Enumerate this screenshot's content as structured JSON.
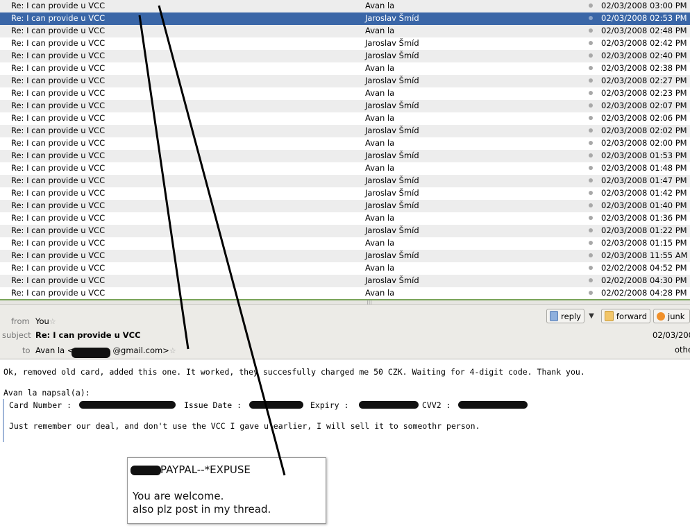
{
  "message_list": [
    {
      "subject": "Re: I can provide u VCC",
      "sender": "Avan la",
      "date": "02/03/2008 03:00 PM",
      "selected": false
    },
    {
      "subject": "Re: I can provide u VCC",
      "sender": "Jaroslav Šmíd",
      "date": "02/03/2008 02:53 PM",
      "selected": true
    },
    {
      "subject": "Re: I can provide u VCC",
      "sender": "Avan la",
      "date": "02/03/2008 02:48 PM",
      "selected": false
    },
    {
      "subject": "Re: I can provide u VCC",
      "sender": "Jaroslav Šmíd",
      "date": "02/03/2008 02:42 PM",
      "selected": false
    },
    {
      "subject": "Re: I can provide u VCC",
      "sender": "Jaroslav Šmíd",
      "date": "02/03/2008 02:40 PM",
      "selected": false
    },
    {
      "subject": "Re: I can provide u VCC",
      "sender": "Avan la",
      "date": "02/03/2008 02:38 PM",
      "selected": false
    },
    {
      "subject": "Re: I can provide u VCC",
      "sender": "Jaroslav Šmíd",
      "date": "02/03/2008 02:27 PM",
      "selected": false
    },
    {
      "subject": "Re: I can provide u VCC",
      "sender": "Avan la",
      "date": "02/03/2008 02:23 PM",
      "selected": false
    },
    {
      "subject": "Re: I can provide u VCC",
      "sender": "Jaroslav Šmíd",
      "date": "02/03/2008 02:07 PM",
      "selected": false
    },
    {
      "subject": "Re: I can provide u VCC",
      "sender": "Avan la",
      "date": "02/03/2008 02:06 PM",
      "selected": false
    },
    {
      "subject": "Re: I can provide u VCC",
      "sender": "Jaroslav Šmíd",
      "date": "02/03/2008 02:02 PM",
      "selected": false
    },
    {
      "subject": "Re: I can provide u VCC",
      "sender": "Avan la",
      "date": "02/03/2008 02:00 PM",
      "selected": false
    },
    {
      "subject": "Re: I can provide u VCC",
      "sender": "Jaroslav Šmíd",
      "date": "02/03/2008 01:53 PM",
      "selected": false
    },
    {
      "subject": "Re: I can provide u VCC",
      "sender": "Avan la",
      "date": "02/03/2008 01:48 PM",
      "selected": false
    },
    {
      "subject": "Re: I can provide u VCC",
      "sender": "Jaroslav Šmíd",
      "date": "02/03/2008 01:47 PM",
      "selected": false
    },
    {
      "subject": "Re: I can provide u VCC",
      "sender": "Jaroslav Šmíd",
      "date": "02/03/2008 01:42 PM",
      "selected": false
    },
    {
      "subject": "Re: I can provide u VCC",
      "sender": "Jaroslav Šmíd",
      "date": "02/03/2008 01:40 PM",
      "selected": false
    },
    {
      "subject": "Re: I can provide u VCC",
      "sender": "Avan la",
      "date": "02/03/2008 01:36 PM",
      "selected": false
    },
    {
      "subject": "Re: I can provide u VCC",
      "sender": "Jaroslav Šmíd",
      "date": "02/03/2008 01:22 PM",
      "selected": false
    },
    {
      "subject": "Re: I can provide u VCC",
      "sender": "Avan la",
      "date": "02/03/2008 01:15 PM",
      "selected": false
    },
    {
      "subject": "Re: I can provide u VCC",
      "sender": "Jaroslav Šmíd",
      "date": "02/03/2008 11:55 AM",
      "selected": false
    },
    {
      "subject": "Re: I can provide u VCC",
      "sender": "Avan la",
      "date": "02/02/2008 04:52 PM",
      "selected": false
    },
    {
      "subject": "Re: I can provide u VCC",
      "sender": "Jaroslav Šmíd",
      "date": "02/02/2008 04:30 PM",
      "selected": false
    },
    {
      "subject": "Re: I can provide u VCC",
      "sender": "Avan la",
      "date": "02/02/2008 04:28 PM",
      "selected": false
    }
  ],
  "header": {
    "from_label": "from",
    "from_value": "You",
    "subject_label": "subject",
    "subject_value": "Re: I can provide u VCC",
    "to_label": "to",
    "to_name": "Avan la <",
    "to_domain": "@gmail.com>",
    "date_partial": "02/03/200",
    "other_partial": "othe",
    "buttons": {
      "reply": "reply",
      "forward": "forward",
      "junk": "junk"
    }
  },
  "body": {
    "line1": "Ok, removed old card, added this one. It worked, they succesfully charged me 50 CZK. Waiting for 4-digit code. Thank you.",
    "quote_header": "Avan la napsal(a):",
    "card_number_label": "Card Number  :",
    "issue_date_label": "Issue Date  :",
    "expiry_label": "Expiry  :",
    "cvv_label": "CVV2  :",
    "quote_line2": "Just remember our deal, and don't use the VCC I gave u earlier, I will sell it to someothr person."
  },
  "comment": {
    "title": "PAYPAL--*EXPUSE",
    "line1": "You are welcome.",
    "line2": "also plz post in my thread."
  },
  "colors": {
    "selection": "#3a66a7",
    "divider": "#7aa55a",
    "header_bg": "#ecebe7"
  }
}
